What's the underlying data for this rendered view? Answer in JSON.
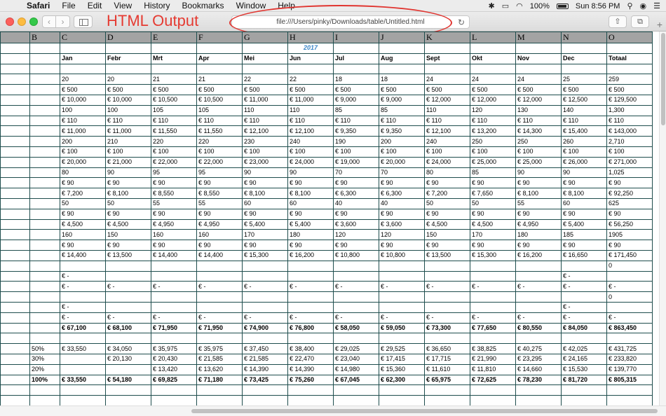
{
  "menubar": {
    "app": "Safari",
    "items": [
      "File",
      "Edit",
      "View",
      "History",
      "Bookmarks",
      "Window",
      "Help"
    ],
    "battery": "100%",
    "clock": "Sun 8:56 PM"
  },
  "toolbar": {
    "overlay_title": "HTML Output",
    "url": "file:///Users/pinky/Downloads/table/Untitled.html"
  },
  "table": {
    "columns": [
      "B",
      "C",
      "D",
      "E",
      "F",
      "G",
      "H",
      "I",
      "J",
      "K",
      "L",
      "M",
      "N",
      "O"
    ],
    "year": "2017",
    "months": [
      "Jan",
      "Febr",
      "Mrt",
      "Apr",
      "Mei",
      "Jun",
      "Jul",
      "Aug",
      "Sept",
      "Okt",
      "Nov",
      "Dec",
      "Totaal"
    ],
    "rows": [
      [
        "",
        "20",
        "20",
        "21",
        "21",
        "22",
        "22",
        "18",
        "18",
        "24",
        "24",
        "24",
        "25",
        "259"
      ],
      [
        "",
        "€ 500",
        "€ 500",
        "€ 500",
        "€ 500",
        "€ 500",
        "€ 500",
        "€ 500",
        "€ 500",
        "€ 500",
        "€ 500",
        "€ 500",
        "€ 500",
        "€ 500"
      ],
      [
        "",
        "€ 10,000",
        "€ 10,000",
        "€ 10,500",
        "€ 10,500",
        "€ 11,000",
        "€ 11,000",
        "€ 9,000",
        "€ 9,000",
        "€ 12,000",
        "€ 12,000",
        "€ 12,000",
        "€ 12,500",
        "€ 129,500"
      ],
      [
        "",
        "100",
        "100",
        "105",
        "105",
        "110",
        "110",
        "85",
        "85",
        "110",
        "120",
        "130",
        "140",
        "1,300"
      ],
      [
        "",
        "€ 110",
        "€ 110",
        "€ 110",
        "€ 110",
        "€ 110",
        "€ 110",
        "€ 110",
        "€ 110",
        "€ 110",
        "€ 110",
        "€ 110",
        "€ 110",
        "€ 110"
      ],
      [
        "",
        "€ 11,000",
        "€ 11,000",
        "€ 11,550",
        "€ 11,550",
        "€ 12,100",
        "€ 12,100",
        "€ 9,350",
        "€ 9,350",
        "€ 12,100",
        "€ 13,200",
        "€ 14,300",
        "€ 15,400",
        "€ 143,000"
      ],
      [
        "",
        "200",
        "210",
        "220",
        "220",
        "230",
        "240",
        "190",
        "200",
        "240",
        "250",
        "250",
        "260",
        "2,710"
      ],
      [
        "",
        "€ 100",
        "€ 100",
        "€ 100",
        "€ 100",
        "€ 100",
        "€ 100",
        "€ 100",
        "€ 100",
        "€ 100",
        "€ 100",
        "€ 100",
        "€ 100",
        "€ 100"
      ],
      [
        "",
        "€ 20,000",
        "€ 21,000",
        "€ 22,000",
        "€ 22,000",
        "€ 23,000",
        "€ 24,000",
        "€ 19,000",
        "€ 20,000",
        "€ 24,000",
        "€ 25,000",
        "€ 25,000",
        "€ 26,000",
        "€ 271,000"
      ],
      [
        "",
        "80",
        "90",
        "95",
        "95",
        "90",
        "90",
        "70",
        "70",
        "80",
        "85",
        "90",
        "90",
        "1,025"
      ],
      [
        "",
        "€ 90",
        "€ 90",
        "€ 90",
        "€ 90",
        "€ 90",
        "€ 90",
        "€ 90",
        "€ 90",
        "€ 90",
        "€ 90",
        "€ 90",
        "€ 90",
        "€ 90"
      ],
      [
        "",
        "€ 7,200",
        "€ 8,100",
        "€ 8,550",
        "€ 8,550",
        "€ 8,100",
        "€ 8,100",
        "€ 6,300",
        "€ 6,300",
        "€ 7,200",
        "€ 7,650",
        "€ 8,100",
        "€ 8,100",
        "€ 92,250"
      ],
      [
        "",
        "50",
        "50",
        "55",
        "55",
        "60",
        "60",
        "40",
        "40",
        "50",
        "50",
        "55",
        "60",
        "625"
      ],
      [
        "",
        "€ 90",
        "€ 90",
        "€ 90",
        "€ 90",
        "€ 90",
        "€ 90",
        "€ 90",
        "€ 90",
        "€ 90",
        "€ 90",
        "€ 90",
        "€ 90",
        "€ 90"
      ],
      [
        "",
        "€ 4,500",
        "€ 4,500",
        "€ 4,950",
        "€ 4,950",
        "€ 5,400",
        "€ 5,400",
        "€ 3,600",
        "€ 3,600",
        "€ 4,500",
        "€ 4,500",
        "€ 4,950",
        "€ 5,400",
        "€ 56,250"
      ],
      [
        "",
        "160",
        "150",
        "160",
        "160",
        "170",
        "180",
        "120",
        "120",
        "150",
        "170",
        "180",
        "185",
        "1905"
      ],
      [
        "",
        "€ 90",
        "€ 90",
        "€ 90",
        "€ 90",
        "€ 90",
        "€ 90",
        "€ 90",
        "€ 90",
        "€ 90",
        "€ 90",
        "€ 90",
        "€ 90",
        "€ 90"
      ],
      [
        "",
        "€ 14,400",
        "€ 13,500",
        "€ 14,400",
        "€ 14,400",
        "€ 15,300",
        "€ 16,200",
        "€ 10,800",
        "€ 10,800",
        "€ 13,500",
        "€ 15,300",
        "€ 16,200",
        "€ 16,650",
        "€ 171,450"
      ],
      [
        "",
        "",
        "",
        "",
        "",
        "",
        "",
        "",
        "",
        "",
        "",
        "",
        "",
        "0"
      ],
      [
        "",
        "€ -",
        "",
        "",
        "",
        "",
        "",
        "",
        "",
        "",
        "",
        "",
        "€ -",
        ""
      ],
      [
        "",
        "€ -",
        "€ -",
        "€ -",
        "€ -",
        "€ -",
        "€ -",
        "€ -",
        "€ -",
        "€ -",
        "€ -",
        "€ -",
        "€ -",
        "€ -"
      ],
      [
        "",
        "",
        "",
        "",
        "",
        "",
        "",
        "",
        "",
        "",
        "",
        "",
        "",
        "0"
      ],
      [
        "",
        "€ -",
        "",
        "",
        "",
        "",
        "",
        "",
        "",
        "",
        "",
        "",
        "€ -",
        ""
      ],
      [
        "",
        "€ -",
        "€ -",
        "€ -",
        "€ -",
        "€ -",
        "€ -",
        "€ -",
        "€ -",
        "€ -",
        "€ -",
        "€ -",
        "€ -",
        "€ -"
      ]
    ],
    "total_row": [
      "",
      "€ 67,100",
      "€ 68,100",
      "€ 71,950",
      "€ 71,950",
      "€ 74,900",
      "€ 76,800",
      "€ 58,050",
      "€ 59,050",
      "€ 73,300",
      "€ 77,650",
      "€ 80,550",
      "€ 84,050",
      "€ 863,450"
    ],
    "pct_rows": [
      [
        "50%",
        "€ 33,550",
        "€ 34,050",
        "€ 35,975",
        "€ 35,975",
        "€ 37,450",
        "€ 38,400",
        "€ 29,025",
        "€ 29,525",
        "€ 36,650",
        "€ 38,825",
        "€ 40,275",
        "€ 42,025",
        "€ 431,725"
      ],
      [
        "30%",
        "",
        "€ 20,130",
        "€ 20,430",
        "€ 21,585",
        "€ 21,585",
        "€ 22,470",
        "€ 23,040",
        "€ 17,415",
        "€ 17,715",
        "€ 21,990",
        "€ 23,295",
        "€ 24,165",
        "€ 233,820"
      ],
      [
        "20%",
        "",
        "",
        "€ 13,420",
        "€ 13,620",
        "€ 14,390",
        "€ 14,390",
        "€ 14,980",
        "€ 15,360",
        "€ 11,610",
        "€ 11,810",
        "€ 14,660",
        "€ 15,530",
        "€ 139,770"
      ]
    ],
    "sum_row": [
      "100%",
      "€ 33,550",
      "€ 54,180",
      "€ 69,825",
      "€ 71,180",
      "€ 73,425",
      "€ 75,260",
      "€ 67,045",
      "€ 62,300",
      "€ 65,975",
      "€ 72,625",
      "€ 78,230",
      "€ 81,720",
      "€ 805,315"
    ]
  }
}
